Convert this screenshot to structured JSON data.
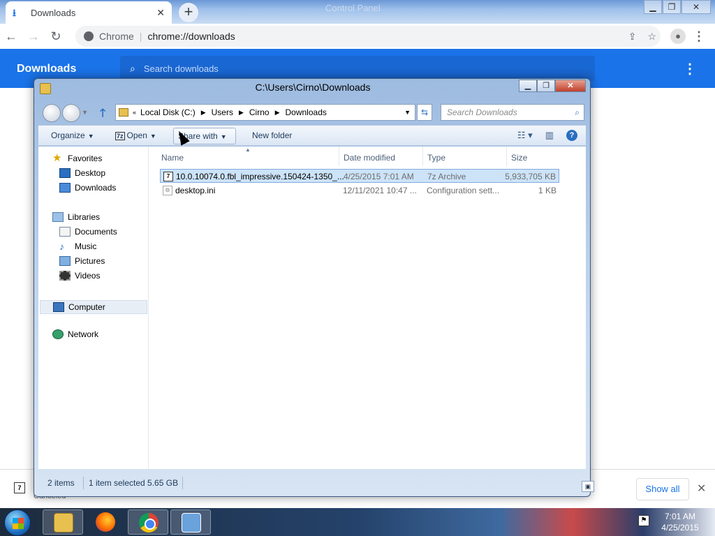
{
  "chrome": {
    "tab_title": "Downloads",
    "background_tab_title": "Control Panel",
    "omnibox_origin": "Chrome",
    "omnibox_url": "chrome://downloads",
    "page_title": "Downloads",
    "search_placeholder": "Search downloads",
    "shelf": {
      "item_status": "Canceled",
      "show_all": "Show all"
    }
  },
  "explorer": {
    "window_title": "C:\\Users\\Cirno\\Downloads",
    "breadcrumb": [
      "Local Disk (C:)",
      "Users",
      "Cirno",
      "Downloads"
    ],
    "search_placeholder": "Search Downloads",
    "commands": {
      "organize": "Organize",
      "open": "Open",
      "share_with": "Share with",
      "new_folder": "New folder"
    },
    "nav": {
      "favorites": "Favorites",
      "desktop": "Desktop",
      "downloads": "Downloads",
      "libraries": "Libraries",
      "documents": "Documents",
      "music": "Music",
      "pictures": "Pictures",
      "videos": "Videos",
      "computer": "Computer",
      "network": "Network"
    },
    "columns": {
      "name": "Name",
      "date": "Date modified",
      "type": "Type",
      "size": "Size"
    },
    "files": [
      {
        "name": "10.0.10074.0.fbl_impressive.150424-1350_...",
        "date": "4/25/2015 7:01 AM",
        "type": "7z Archive",
        "size": "5,933,705 KB",
        "selected": true
      },
      {
        "name": "desktop.ini",
        "date": "12/11/2021 10:47 ...",
        "type": "Configuration sett...",
        "size": "1 KB",
        "selected": false
      }
    ],
    "status": {
      "count": "2 items",
      "selection": "1 item selected  5.65 GB"
    }
  },
  "taskbar": {
    "time": "7:01 AM",
    "date": "4/25/2015",
    "apps": [
      "explorer-icon",
      "firefox-icon",
      "chrome-icon",
      "control-panel-icon"
    ]
  },
  "colors": {
    "chrome_blue": "#1a73e8",
    "selection": "#cce3f8"
  }
}
